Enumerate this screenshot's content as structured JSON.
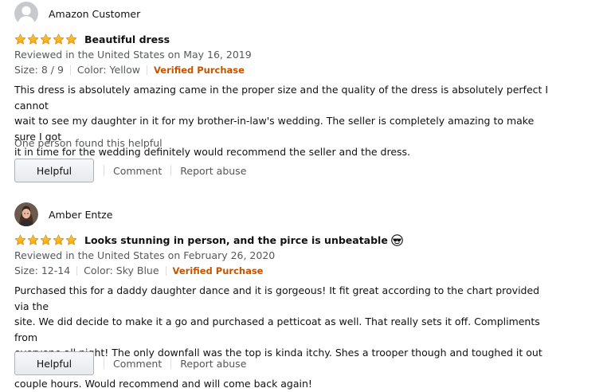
{
  "reviews": [
    {
      "profile_name": "Amazon Customer",
      "avatar": "default-avatar-icon",
      "rating": 5,
      "title": "Beautiful dress",
      "date": "Reviewed in the United States on May 16, 2019",
      "size": "Size: 8 / 9",
      "color": "Color: Yellow",
      "verified": "Verified Purchase",
      "body_lines": [
        "This dress is absolutely amazing came in the proper size and the quality of the dress is absolutely perfect I cannot",
        "wait to see my daughter in it for my brother-in-law's wedding. The seller is completely amazing to make sure I got",
        "it in time for the wedding definitely would recommend the seller and the dress."
      ],
      "helpful_count": "One person found this helpful",
      "helpful_label": "Helpful",
      "comment_label": "Comment",
      "report_label": "Report abuse"
    },
    {
      "profile_name": "Amber Entze",
      "avatar": "photo-avatar",
      "rating": 5,
      "title": "Looks stunning in person, and the pirce is unbeatable",
      "title_emoji": "sunglasses-emoji-icon",
      "date": "Reviewed in the United States on February 26, 2020",
      "size": "Size: 12-14",
      "color": "Color: Sky Blue",
      "verified": "Verified Purchase",
      "body_lines": [
        "Purchased this for a daddy daughter dance and it is gorgeous! It fit great according to the chart provided via the",
        "site. We did decide to make it a go and purchased a petticoat as well. That really sets it off. Compliments from",
        "everyone all night! The only downfall was the top is kinda itchy. Shes a trooper though and toughed it out for a",
        "couple hours. Would recommend and will come back again!"
      ],
      "helpful_label": "Helpful",
      "comment_label": "Comment",
      "report_label": "Report abuse"
    }
  ],
  "colors": {
    "star": "#ffa41c",
    "verified": "#c45500",
    "muted_text": "#565959"
  }
}
